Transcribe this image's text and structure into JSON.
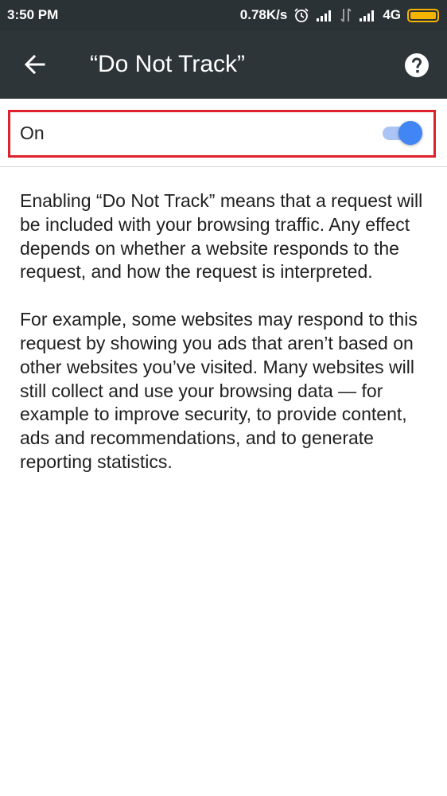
{
  "status_bar": {
    "time": "3:50 PM",
    "network_speed": "0.78K/s",
    "network_type": "4G",
    "icons": [
      "alarm-icon",
      "signal-icon",
      "data-transfer-icon",
      "signal-icon",
      "battery-icon"
    ],
    "battery_color": "#f5b400"
  },
  "app_bar": {
    "title": "“Do Not Track”",
    "back_icon": "arrow-back-icon",
    "help_icon": "help-circle-icon",
    "background": "#2e3539"
  },
  "setting": {
    "label": "On",
    "toggle_on": true,
    "accent": "#4285f4",
    "highlight_color": "#e0202b"
  },
  "description": {
    "paragraph_1": "Enabling “Do Not Track” means that a request will be included with your browsing traffic. Any effect depends on whether a website responds to the request, and how the request is interpreted.",
    "paragraph_2": "For example, some websites may respond to this request by showing you ads that aren’t based on other websites you’ve visited. Many websites will still collect and use your brows­ing data — for example to improve security, to provide content, ads and recommendations, and to generate reporting statistics."
  }
}
